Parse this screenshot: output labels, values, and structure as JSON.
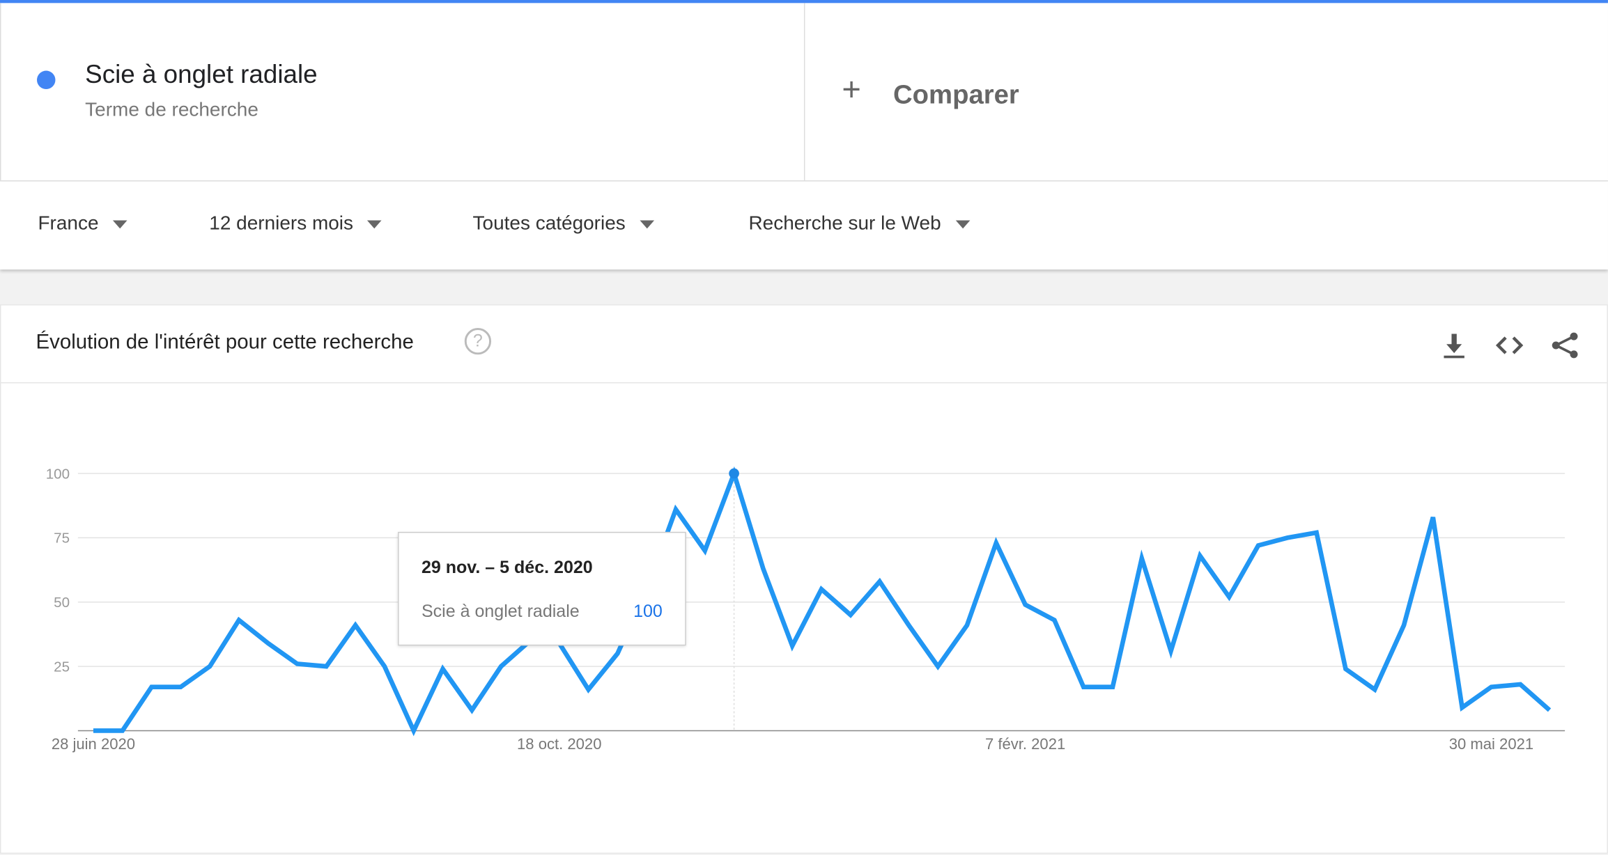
{
  "term": {
    "name": "Scie à onglet radiale",
    "subtitle": "Terme de recherche",
    "color": "#4285f4"
  },
  "compare": {
    "label": "Comparer",
    "icon": "plus-icon"
  },
  "filters": [
    {
      "label": "France"
    },
    {
      "label": "12 derniers mois"
    },
    {
      "label": "Toutes catégories"
    },
    {
      "label": "Recherche sur le Web"
    }
  ],
  "card": {
    "title": "Évolution de l'intérêt pour cette recherche",
    "icons": [
      "help-icon",
      "download-icon",
      "embed-code-icon",
      "share-icon"
    ]
  },
  "tooltip": {
    "date": "29 nov. – 5 déc. 2020",
    "series": "Scie à onglet radiale",
    "value": "100"
  },
  "chart_data": {
    "type": "line",
    "line_color": "#2196f3",
    "ylim": [
      0,
      100
    ],
    "yticks": [
      "100",
      "75",
      "50",
      "25"
    ],
    "xtick_labels": [
      "28 juin 2020",
      "18 oct. 2020",
      "7 févr. 2021",
      "30 mai 2021"
    ],
    "grid": true,
    "x": [
      "2020-06-28",
      "2020-07-05",
      "2020-07-12",
      "2020-07-19",
      "2020-07-26",
      "2020-08-02",
      "2020-08-09",
      "2020-08-16",
      "2020-08-23",
      "2020-08-30",
      "2020-09-06",
      "2020-09-13",
      "2020-09-20",
      "2020-09-27",
      "2020-10-04",
      "2020-10-11",
      "2020-10-18",
      "2020-10-25",
      "2020-11-01",
      "2020-11-08",
      "2020-11-15",
      "2020-11-22",
      "2020-11-29",
      "2020-12-06",
      "2020-12-13",
      "2020-12-20",
      "2020-12-27",
      "2021-01-03",
      "2021-01-10",
      "2021-01-17",
      "2021-01-24",
      "2021-01-31",
      "2021-02-07",
      "2021-02-14",
      "2021-02-21",
      "2021-02-28",
      "2021-03-07",
      "2021-03-14",
      "2021-03-21",
      "2021-03-28",
      "2021-04-04",
      "2021-04-11",
      "2021-04-18",
      "2021-04-25",
      "2021-05-02",
      "2021-05-09",
      "2021-05-16",
      "2021-05-23",
      "2021-05-30",
      "2021-06-06",
      "2021-06-13"
    ],
    "series": [
      {
        "name": "Scie à onglet radiale",
        "values": [
          0,
          0,
          17,
          17,
          25,
          43,
          34,
          26,
          25,
          41,
          25,
          0,
          24,
          8,
          25,
          35,
          34,
          16,
          30,
          55,
          86,
          70,
          100,
          63,
          33,
          55,
          45,
          58,
          41,
          25,
          41,
          73,
          49,
          43,
          17,
          17,
          67,
          31,
          68,
          52,
          72,
          75,
          77,
          24,
          16,
          41,
          83,
          9,
          17,
          18,
          8
        ]
      }
    ],
    "highlight_index": 22
  }
}
